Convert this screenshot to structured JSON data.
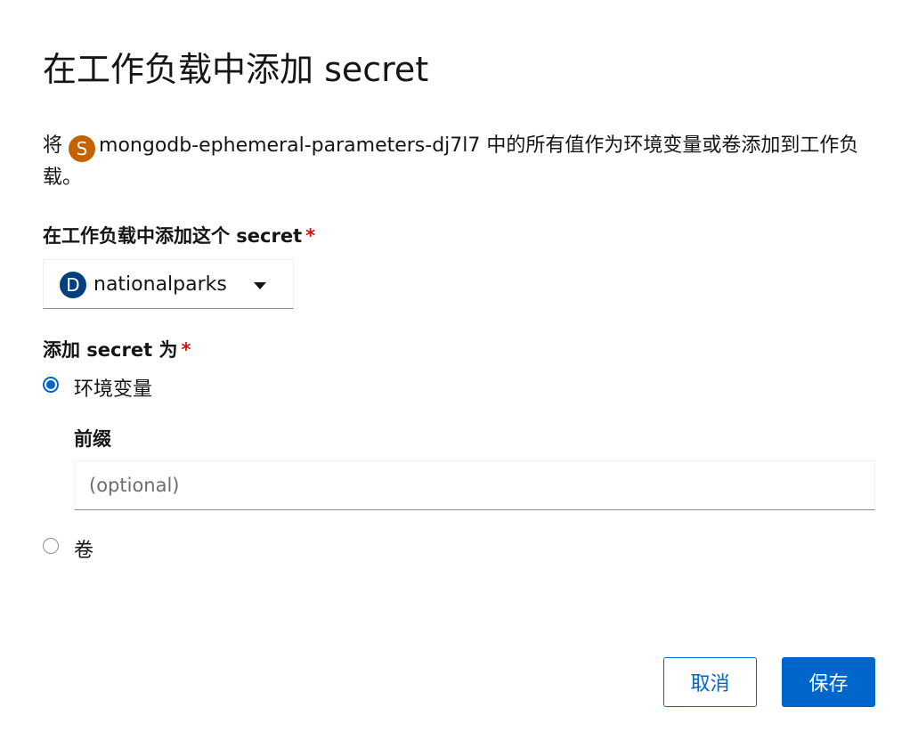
{
  "dialog": {
    "title": "在工作负载中添加 secret",
    "description": {
      "prefix": "将",
      "resource_badge": "S",
      "resource_name": "mongodb-ephemeral-parameters-dj7l7",
      "suffix": "中的所有值作为环境变量或卷添加到工作负载。"
    }
  },
  "workload": {
    "label": "在工作负载中添加这个 secret",
    "required_mark": "*",
    "selected_badge": "D",
    "selected_value": "nationalparks"
  },
  "add_as": {
    "label": "添加 secret 为",
    "required_mark": "*",
    "options": [
      {
        "label": "环境变量",
        "checked": true
      },
      {
        "label": "卷",
        "checked": false
      }
    ]
  },
  "prefix_field": {
    "label": "前缀",
    "value": "",
    "placeholder": "(optional)"
  },
  "footer": {
    "cancel_label": "取消",
    "save_label": "保存"
  },
  "colors": {
    "primary": "#0066cc",
    "secret_badge": "#c46100",
    "workload_badge": "#004080",
    "required": "#c9190b"
  },
  "icons": {
    "dropdown": "caret-down-icon"
  }
}
